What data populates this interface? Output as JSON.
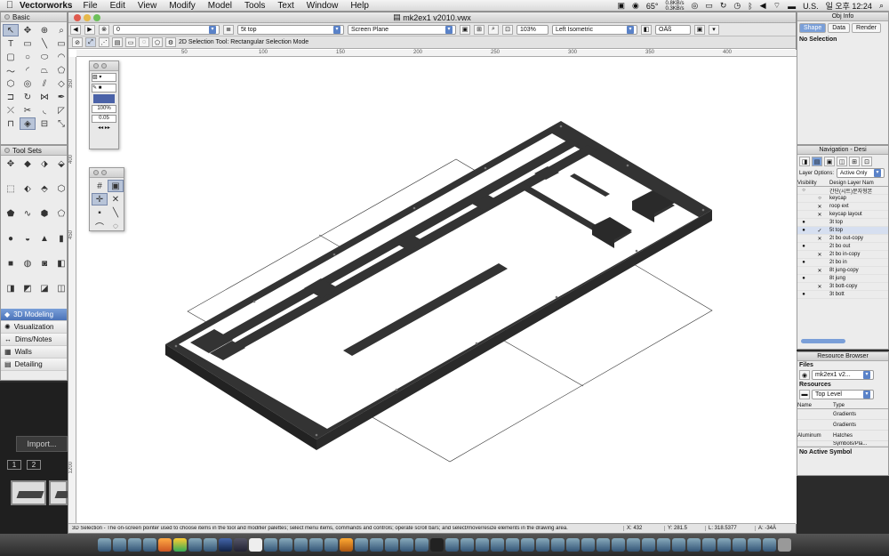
{
  "menubar": {
    "apple": "",
    "app": "Vectorworks",
    "items": [
      "File",
      "Edit",
      "View",
      "Modify",
      "Model",
      "Tools",
      "Text",
      "Window",
      "Help"
    ],
    "temp": "65°",
    "net_up": "0.8KB/s",
    "net_down": "0.3KB/s",
    "lang": "U.S.",
    "clock": "일 오후 12:24"
  },
  "window": {
    "title": "mk2ex1 v2010.vwx"
  },
  "toolbar1": {
    "class_value": "0",
    "layer_value": "5t top",
    "plane_value": "Screen Plane",
    "zoom_value": "103%",
    "view_value": "Left Isometric",
    "render_value": "OÄß"
  },
  "toolbar2": {
    "mode_text": "2D Selection Tool: Rectangular Selection Mode"
  },
  "rulers": {
    "h": [
      "50",
      "100",
      "150",
      "200",
      "250",
      "300",
      "350",
      "400"
    ],
    "v": [
      "350",
      "400",
      "450",
      "1200"
    ]
  },
  "statusbar": {
    "message": "3D Selection - The on-screen pointer used to choose items in the tool and modifier palettes; select menu items, commands and controls; operate scroll bars; and select/move/resize elements in the drawing area.",
    "x": "X: 432",
    "y": "Y: 281.5",
    "l": "L: 318.5377",
    "a": "A: -34Ä"
  },
  "palettes": {
    "basic": {
      "title": "Basic"
    },
    "toolsets": {
      "title": "Tool Sets",
      "items": [
        "3D Modeling",
        "Visualization",
        "Dims/Notes",
        "Walls",
        "Detailing"
      ]
    },
    "attr": {
      "zoom": "100%",
      "line": "0.05"
    }
  },
  "obj_info": {
    "title": "Obj Info",
    "tabs": [
      "Shape",
      "Data",
      "Render"
    ],
    "empty": "No Selection"
  },
  "navigation": {
    "title": "Navigation - Desi",
    "layer_options_label": "Layer Options:",
    "layer_options_value": "Active Only",
    "col_vis": "Visibility",
    "col_name": "Design Layer Nam",
    "layers": [
      {
        "vis": "○",
        "chk": "",
        "name": "간단(시트)문자형본"
      },
      {
        "vis": "",
        "chk": "○",
        "name": "keycap"
      },
      {
        "vis": "",
        "chk": "✕",
        "name": "roop ext"
      },
      {
        "vis": "",
        "chk": "✕",
        "name": "keycap layout"
      },
      {
        "vis": "●",
        "chk": "",
        "name": "3t top"
      },
      {
        "vis": "●",
        "chk": "✓",
        "name": "5t top"
      },
      {
        "vis": "",
        "chk": "✕",
        "name": "2t bo out-copy"
      },
      {
        "vis": "●",
        "chk": "",
        "name": "2t bo out"
      },
      {
        "vis": "",
        "chk": "✕",
        "name": "2t bo in-copy"
      },
      {
        "vis": "●",
        "chk": "",
        "name": "2t bo in"
      },
      {
        "vis": "",
        "chk": "✕",
        "name": "8t jung-copy"
      },
      {
        "vis": "●",
        "chk": "",
        "name": "8t jung"
      },
      {
        "vis": "",
        "chk": "✕",
        "name": "3t bott-copy"
      },
      {
        "vis": "●",
        "chk": "",
        "name": "3t bott"
      }
    ]
  },
  "resource_browser": {
    "title": "Resource Browser",
    "files_label": "Files",
    "file_value": "mk2ex1 v2...",
    "resources_label": "Resources",
    "level_value": "Top Level",
    "col_name": "Name",
    "col_type": "Type",
    "rows": [
      {
        "name": "",
        "type": "Gradients"
      },
      {
        "name": "",
        "type": "Gradients"
      },
      {
        "name": "Aluminum",
        "type": "Hatches"
      },
      {
        "name": "",
        "type": "Symbols/Pla..."
      }
    ],
    "active_symbol": "No Active Symbol"
  },
  "desktop": {
    "import_label": "Import...",
    "pages": [
      "1",
      "2"
    ]
  }
}
